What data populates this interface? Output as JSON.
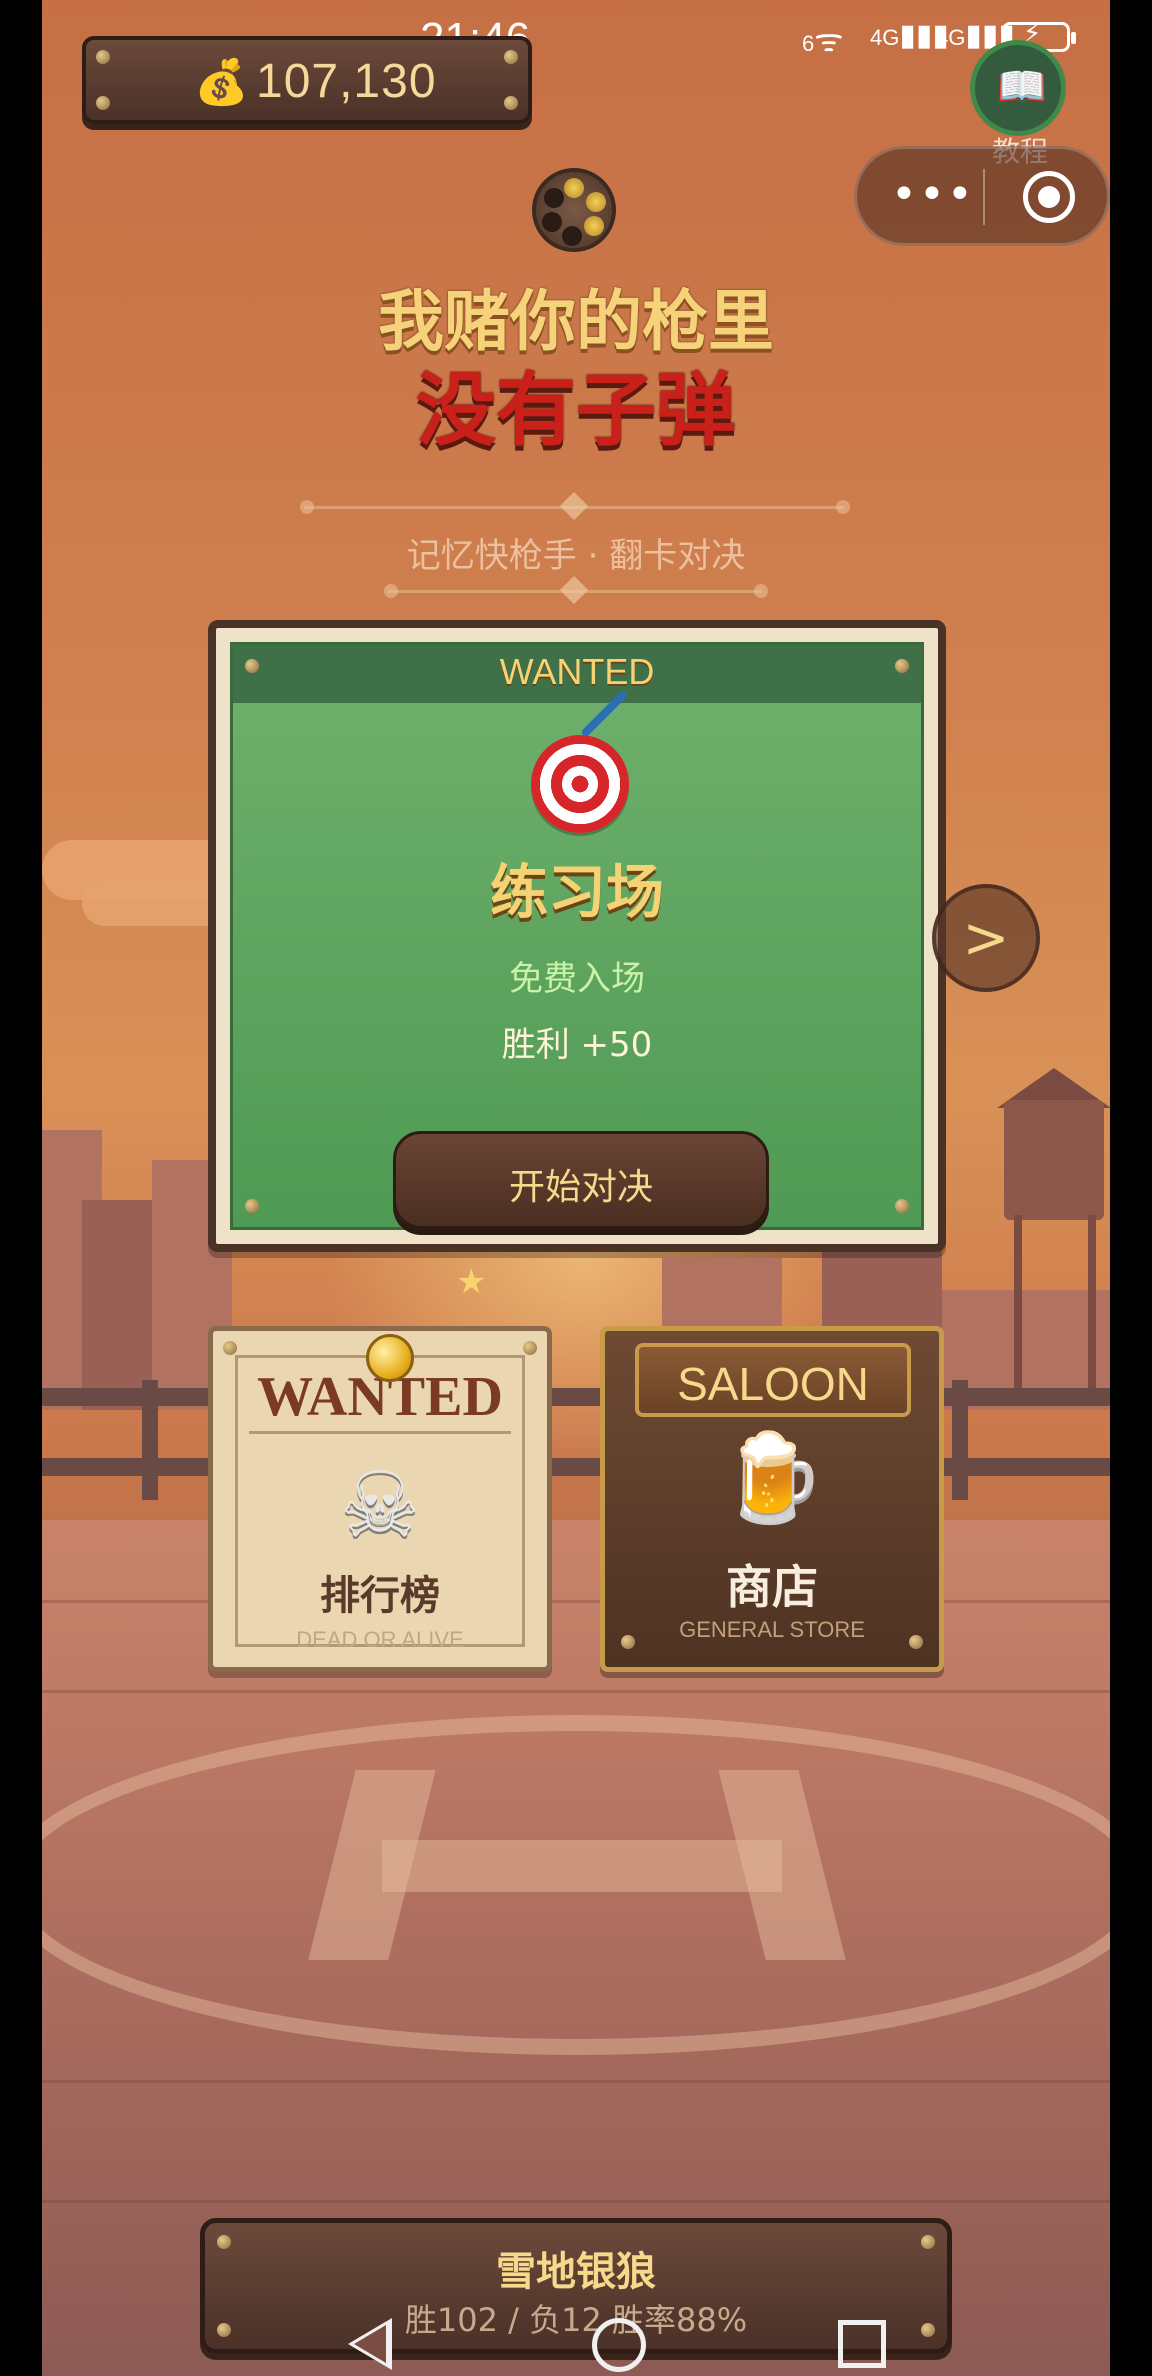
{
  "status_bar": {
    "time": "21:46",
    "signal_wifi": "6",
    "signal_1": "4G",
    "signal_2": "4G"
  },
  "header": {
    "coins": "107,130",
    "tutorial_label": "教程"
  },
  "title": {
    "line1": "我赌你的枪里",
    "line2": "没有子弹",
    "subtitle": "记忆快枪手 · 翻卡对决"
  },
  "mode_card": {
    "tag": "WANTED",
    "title": "练习场",
    "entry": "免费入场",
    "reward": "胜利 +50",
    "start_button": "开始对决",
    "next_button": ">"
  },
  "leaderboard": {
    "header": "WANTED",
    "title": "排行榜",
    "subtitle": "DEAD OR ALIVE"
  },
  "shop": {
    "sign": "SALOON",
    "title": "商店",
    "subtitle": "GENERAL STORE"
  },
  "player": {
    "name": "雪地银狼",
    "stats": "胜102 / 负12  胜率88%"
  },
  "icons": {
    "coin_bag": "money-bag",
    "tutorial": "book",
    "revolver": "revolver-cylinder",
    "target": "dartboard",
    "skull": "skull-crossbones",
    "beer": "beer-mug",
    "star": "star"
  },
  "colors": {
    "gold_text": "#f6d27a",
    "title_red": "#c9201a",
    "card_green": "#5fa45f",
    "wood": "#4b3128"
  }
}
